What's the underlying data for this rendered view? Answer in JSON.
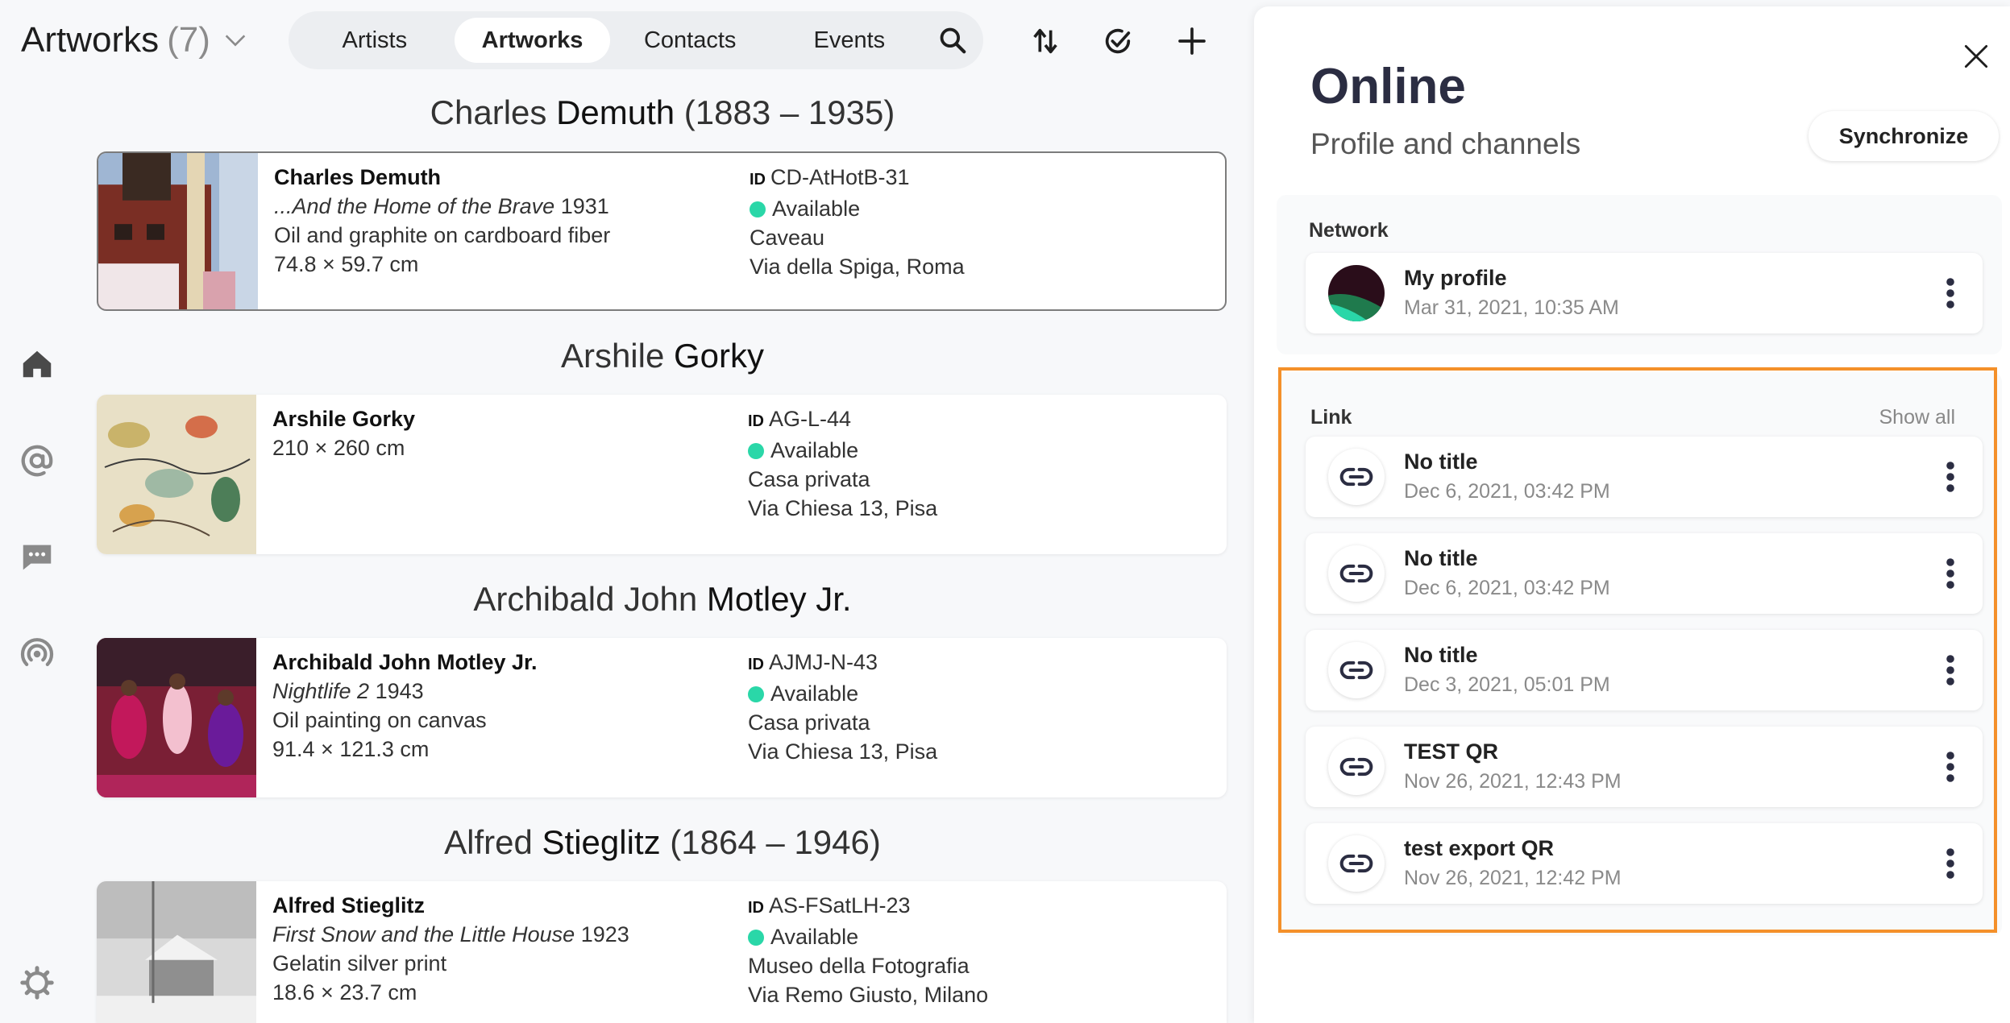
{
  "header": {
    "title": "Artworks",
    "count": "(7)"
  },
  "nav": {
    "tabs": [
      {
        "label": "Artists"
      },
      {
        "label": "Artworks"
      },
      {
        "label": "Contacts"
      },
      {
        "label": "Events"
      }
    ],
    "active_tab": "Artworks"
  },
  "rail": {
    "icons": [
      "home-icon",
      "at-icon",
      "chat-icon",
      "broadcast-icon",
      "settings-icon"
    ]
  },
  "top_actions": [
    "sort-icon",
    "check-circle-icon",
    "plus-icon"
  ],
  "artworks": [
    {
      "header_first": "Charles ",
      "header_last": "Demuth",
      "header_years": " (1883 – 1935)",
      "name": "Charles Demuth",
      "title": "...And the Home of the Brave",
      "year": "1931",
      "medium": "Oil and graphite on cardboard fiber",
      "size": "74.8 × 59.7 cm",
      "id_label": "ID",
      "id": "CD-AtHotB-31",
      "status": "Available",
      "location": "Caveau",
      "address": "Via della Spiga, Roma"
    },
    {
      "header_first": "Arshile ",
      "header_last": "Gorky",
      "header_years": "",
      "name": "Arshile Gorky",
      "size": "210 × 260 cm",
      "id_label": "ID",
      "id": "AG-L-44",
      "status": "Available",
      "location": "Casa privata",
      "address": "Via Chiesa 13, Pisa"
    },
    {
      "header_first": "Archibald John ",
      "header_last": "Motley Jr.",
      "header_years": "",
      "name": "Archibald John Motley Jr.",
      "title": "Nightlife 2",
      "year": "1943",
      "medium": "Oil painting on canvas",
      "size": "91.4 × 121.3 cm",
      "id_label": "ID",
      "id": "AJMJ-N-43",
      "status": "Available",
      "location": "Casa privata",
      "address": "Via Chiesa 13, Pisa"
    },
    {
      "header_first": "Alfred ",
      "header_last": "Stieglitz",
      "header_years": " (1864 – 1946)",
      "name": "Alfred Stieglitz",
      "title": "First Snow and the Little House",
      "year": "1923",
      "medium": "Gelatin silver print",
      "size": "18.6 × 23.7 cm",
      "id_label": "ID",
      "id": "AS-FSatLH-23",
      "status": "Available",
      "location": "Museo della Fotografia",
      "address": "Via Remo Giusto, Milano"
    }
  ],
  "panel": {
    "title": "Online",
    "subtitle": "Profile and channels",
    "sync_label": "Synchronize",
    "network": {
      "label": "Network",
      "profile_title": "My profile",
      "profile_date": "Mar 31, 2021, 10:35 AM"
    },
    "link": {
      "label": "Link",
      "show_all": "Show all",
      "items": [
        {
          "title": "No title",
          "date": "Dec 6, 2021, 03:42 PM"
        },
        {
          "title": "No title",
          "date": "Dec 6, 2021, 03:42 PM"
        },
        {
          "title": "No title",
          "date": "Dec 3, 2021, 05:01 PM"
        },
        {
          "title": "TEST QR",
          "date": "Nov 26, 2021, 12:43 PM"
        },
        {
          "title": "test export QR",
          "date": "Nov 26, 2021, 12:42 PM"
        }
      ]
    }
  },
  "colors": {
    "available_dot": "#2ad7a8",
    "highlight_border": "#f4902a",
    "panel_title": "#2b2d42"
  }
}
